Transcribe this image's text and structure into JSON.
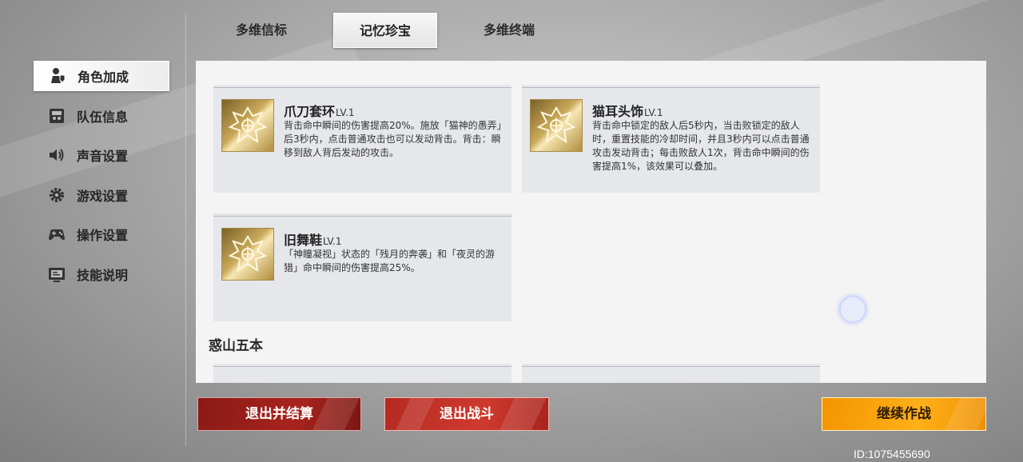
{
  "tabs": [
    {
      "label": "多维信标",
      "active": false
    },
    {
      "label": "记忆珍宝",
      "active": true
    },
    {
      "label": "多维终端",
      "active": false
    }
  ],
  "sidebar": {
    "items": [
      {
        "label": "角色加成",
        "icon": "character-icon",
        "active": true
      },
      {
        "label": "队伍信息",
        "icon": "team-icon",
        "active": false
      },
      {
        "label": "声音设置",
        "icon": "speaker-icon",
        "active": false
      },
      {
        "label": "游戏设置",
        "icon": "gear-icon",
        "active": false
      },
      {
        "label": "操作设置",
        "icon": "gamepad-icon",
        "active": false
      },
      {
        "label": "技能说明",
        "icon": "monitor-icon",
        "active": false
      }
    ]
  },
  "cards": [
    {
      "name": "爪刀套环",
      "level": "LV.1",
      "icon": "treasure-emblem-icon",
      "desc": "背击命中瞬间的伤害提高20%。施放「猫神的愚弄」后3秒内，点击普通攻击也可以发动背击。背击：瞬移到敌人背后发动的攻击。"
    },
    {
      "name": "猫耳头饰",
      "level": "LV.1",
      "icon": "treasure-emblem-icon",
      "desc": "背击命中锁定的敌人后5秒内，当击败锁定的敌人时，重置技能的冷却时间，并且3秒内可以点击普通攻击发动背击；每击败敌人1次，背击命中瞬间的伤害提高1%，该效果可以叠加。"
    },
    {
      "name": "旧舞鞋",
      "level": "LV.1",
      "icon": "treasure-emblem-icon",
      "desc": "「神瞳凝视」状态的「残月的奔袭」和「夜灵的游猎」命中瞬间的伤害提高25%。"
    }
  ],
  "section_title": "惑山五本",
  "buttons": {
    "exit_settle": "退出并结算",
    "exit_battle": "退出战斗",
    "continue": "继续作战"
  },
  "player_id": "ID:1075455690",
  "colors": {
    "red_dark": "#a8231d",
    "red": "#cf3a2f",
    "orange": "#ffb019"
  }
}
